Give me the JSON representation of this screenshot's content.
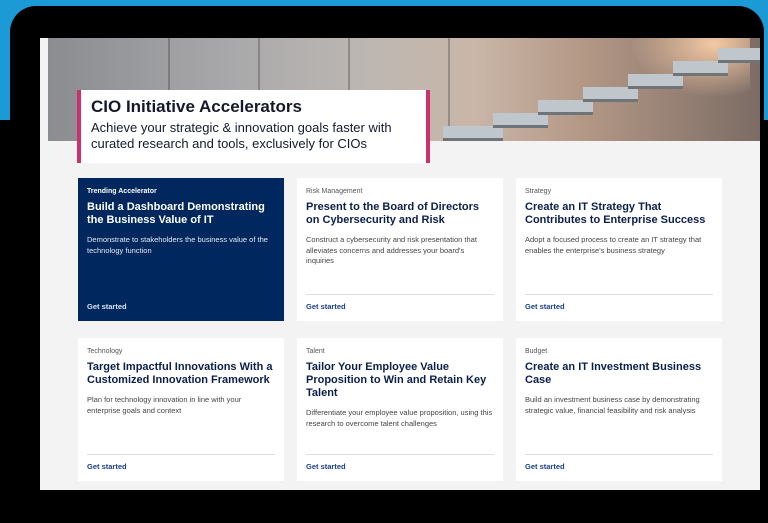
{
  "hero": {
    "title": "CIO Initiative Accelerators",
    "subtitle": "Achieve your strategic & innovation goals faster with curated research and tools, exclusively for CIOs"
  },
  "cards": [
    {
      "tag": "Trending Accelerator",
      "title": "Build a Dashboard Demonstrating the Business Value of IT",
      "description": "Demonstrate to stakeholders the business value of the technology function",
      "cta": "Get started"
    },
    {
      "tag": "Risk Management",
      "title": "Present to the Board of Directors on Cybersecurity and Risk",
      "description": "Construct a cybersecurity and risk presentation that alleviates concerns and addresses your board's inquiries",
      "cta": "Get started"
    },
    {
      "tag": "Strategy",
      "title": "Create an IT Strategy That Contributes to Enterprise Success",
      "description": "Adopt a focused process to create an IT strategy that enables the enterprise's business strategy",
      "cta": "Get started"
    },
    {
      "tag": "Technology",
      "title": "Target Impactful Innovations With a Customized Innovation Framework",
      "description": "Plan for technology innovation in line with your enterprise goals and context",
      "cta": "Get started"
    },
    {
      "tag": "Talent",
      "title": "Tailor Your Employee Value Proposition to Win and Retain Key Talent",
      "description": "Differentiate your employee value proposition, using this research to overcome talent challenges",
      "cta": "Get started"
    },
    {
      "tag": "Budget",
      "title": "Create an IT Investment Business Case",
      "description": "Build an investment business case by demonstrating strategic value, financial feasibility and risk analysis",
      "cta": "Get started"
    }
  ],
  "colors": {
    "featured_card": "#00285f",
    "accent": "#c8336f",
    "link": "#1a3d8f"
  }
}
